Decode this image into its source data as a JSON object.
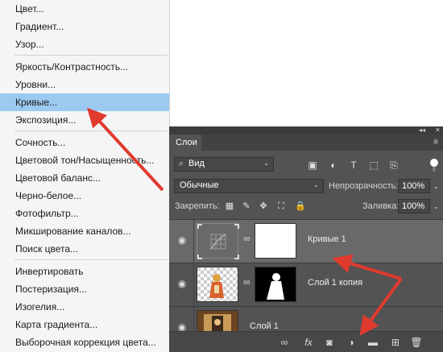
{
  "menu": {
    "items": [
      {
        "label": "Цвет..."
      },
      {
        "label": "Градиент..."
      },
      {
        "label": "Узор..."
      },
      {
        "label": "Яркость/Контрастность..."
      },
      {
        "label": "Уровни..."
      },
      {
        "label": "Кривые..."
      },
      {
        "label": "Экспозиция..."
      },
      {
        "label": "Сочность..."
      },
      {
        "label": "Цветовой тон/Насыщенность..."
      },
      {
        "label": "Цветовой баланс..."
      },
      {
        "label": "Черно-белое..."
      },
      {
        "label": "Фотофильтр..."
      },
      {
        "label": "Микширование каналов..."
      },
      {
        "label": "Поиск цвета..."
      },
      {
        "label": "Инвертировать"
      },
      {
        "label": "Постеризация..."
      },
      {
        "label": "Изогелия..."
      },
      {
        "label": "Карта градиента..."
      },
      {
        "label": "Выборочная коррекция цвета..."
      }
    ],
    "selected": "Кривые..."
  },
  "panel": {
    "collapse_glyph": "◂◂",
    "close_glyph": "✕",
    "tab": "Слои",
    "menu_glyph": "≡",
    "filter": {
      "search_icon": "⌕",
      "kind_label": "Вид",
      "arrow": "⌄"
    },
    "filter_icons": [
      "▣",
      "◐",
      "T",
      "⬚",
      "⎘"
    ],
    "blend_mode": "Обычные",
    "opacity_label": "Непрозрачность:",
    "opacity_value": "100%",
    "lock_label": "Закрепить:",
    "lock_icons": [
      "▦",
      "✎",
      "✥",
      "⛶",
      "🔒"
    ],
    "fill_label": "Заливка:",
    "fill_value": "100%",
    "layers": [
      {
        "name": "Кривые 1",
        "chain": "∞"
      },
      {
        "name": "Слой 1 копия",
        "chain": "∞"
      },
      {
        "name": "Слой 1"
      }
    ],
    "eye_glyph": "◉",
    "bottom_icons": [
      "∞",
      "fx",
      "◙",
      "◑",
      "▬",
      "⊞",
      "🗑"
    ]
  },
  "colors": {
    "menu_bg": "#f5f5f5",
    "menu_selected": "#9bc9f0",
    "panel_bg": "#535353",
    "selected_layer": "#696969",
    "arrow": "#e03a2f"
  }
}
